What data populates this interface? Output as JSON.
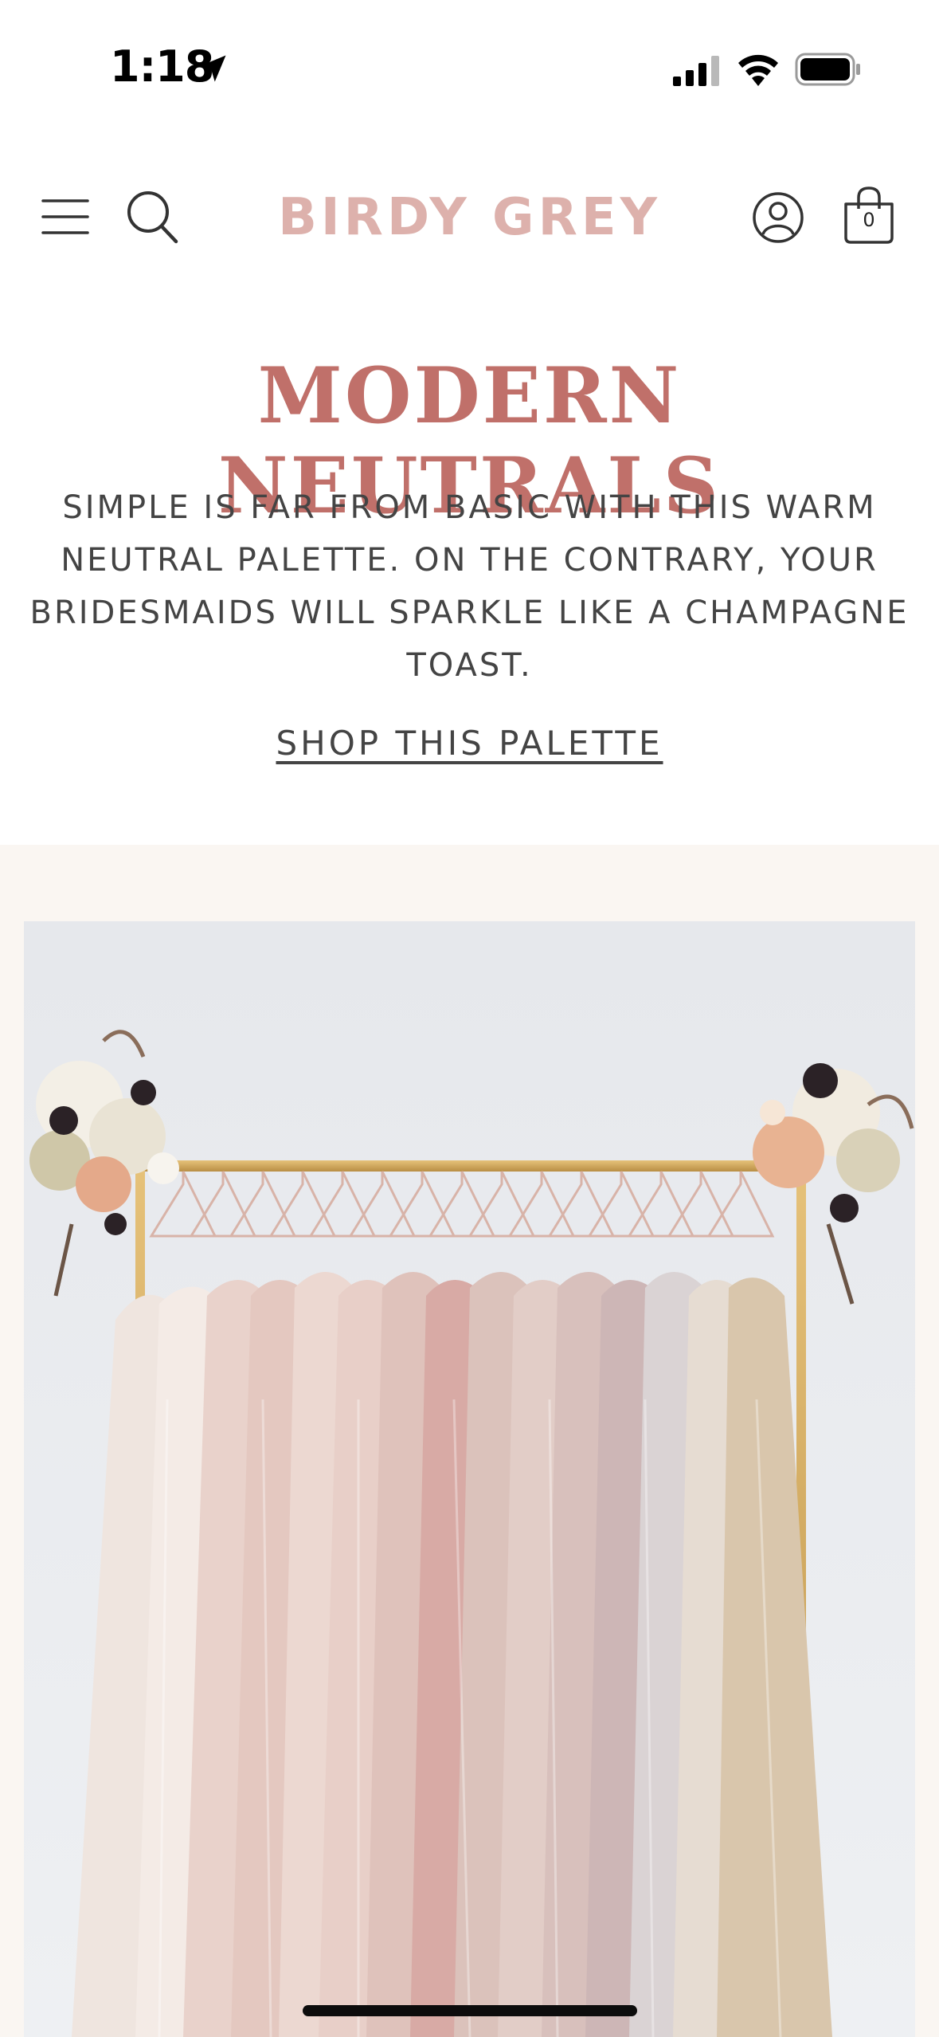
{
  "status_bar": {
    "time": "1:18",
    "icons": [
      "location-arrow-icon",
      "cellular-signal-icon",
      "wifi-icon",
      "battery-icon"
    ]
  },
  "header": {
    "logo": "BIRDY GREY",
    "cart_count": "0",
    "icons": [
      "menu-icon",
      "search-icon",
      "account-icon",
      "shopping-bag-icon"
    ],
    "colors": {
      "logo": "#ddb1ac"
    }
  },
  "hero": {
    "title": "MODERN NEUTRALS",
    "description": "SIMPLE IS FAR FROM BASIC WITH THIS WARM NEUTRAL PALETTE. ON THE CONTRARY, YOUR BRIDESMAIDS WILL SPARKLE LIKE A CHAMPAGNE TOAST.",
    "cta": "SHOP THIS PALETTE",
    "colors": {
      "title": "#c0706a",
      "text": "#444444",
      "section_bg": "#faf6f2"
    }
  }
}
